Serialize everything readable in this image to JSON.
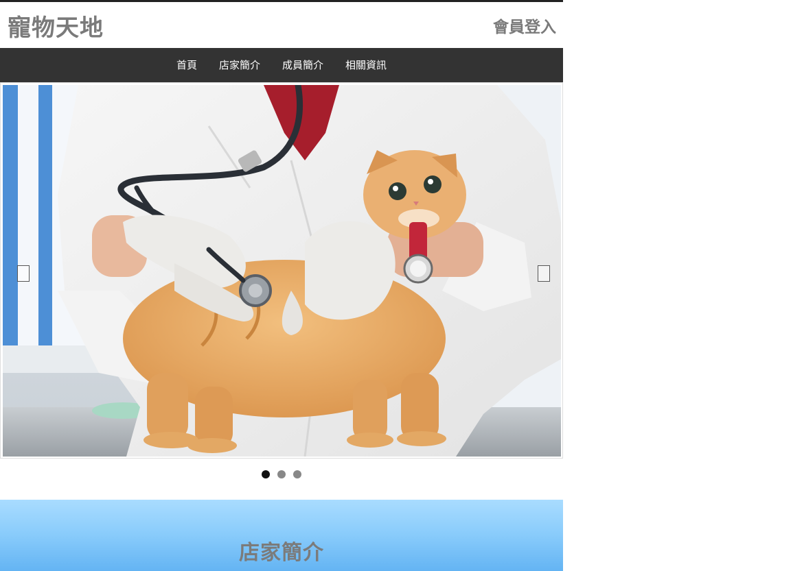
{
  "header": {
    "site_title": "寵物天地",
    "login_label": "會員登入"
  },
  "nav": {
    "items": [
      {
        "label": "首頁"
      },
      {
        "label": "店家簡介"
      },
      {
        "label": "成員簡介"
      },
      {
        "label": "相關資訊"
      }
    ]
  },
  "carousel": {
    "slide_count": 3,
    "active_index": 0
  },
  "about": {
    "title": "店家簡介"
  },
  "colors": {
    "nav_bg": "#333333",
    "title_gray": "#7a7a7a",
    "band_top": "#a9dcff",
    "band_bottom": "#64b4f3"
  },
  "icons": {
    "prev": "chevron-left-icon",
    "next": "chevron-right-icon"
  }
}
